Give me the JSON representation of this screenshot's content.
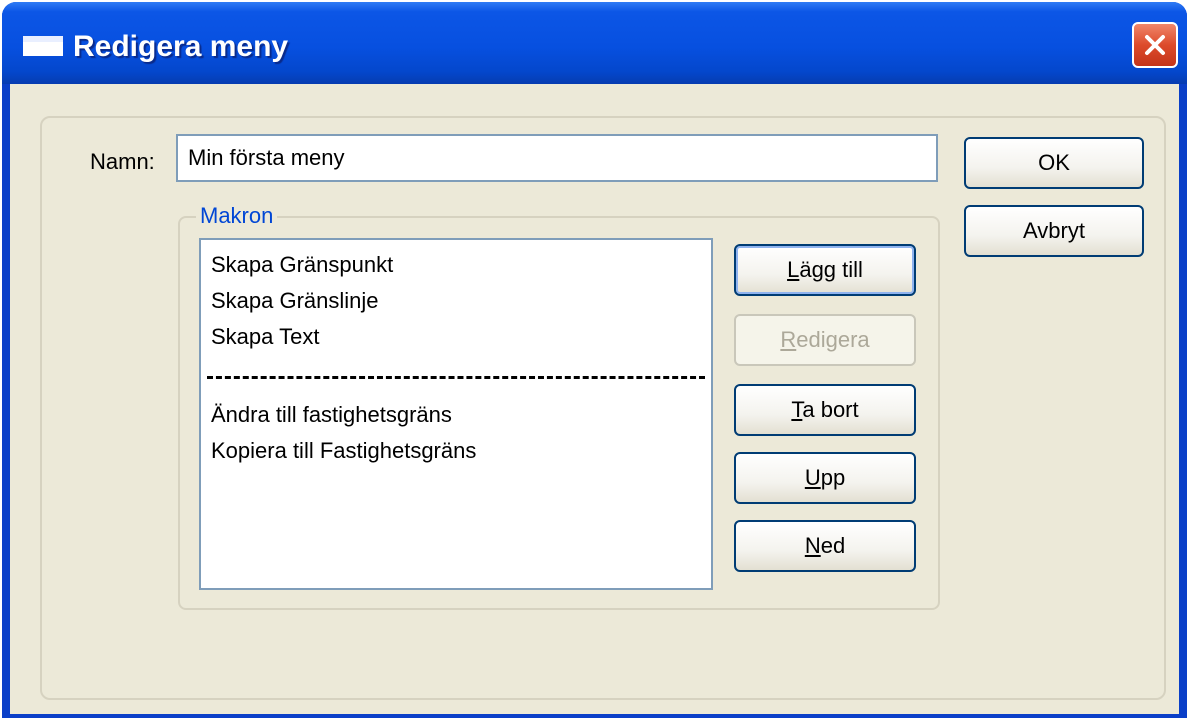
{
  "window": {
    "title": "Redigera meny"
  },
  "form": {
    "name_label": "Namn:",
    "name_value": "Min första meny"
  },
  "buttons": {
    "ok": "OK",
    "cancel": "Avbryt",
    "add": {
      "mnemonic": "L",
      "rest": "ägg till"
    },
    "edit": {
      "mnemonic": "R",
      "rest": "edigera"
    },
    "remove": {
      "mnemonic": "T",
      "rest": "a bort"
    },
    "up": {
      "mnemonic": "U",
      "rest": "pp"
    },
    "down": {
      "mnemonic": "N",
      "rest": "ed"
    }
  },
  "macros": {
    "legend": "Makron",
    "items": [
      "Skapa Gränspunkt",
      "Skapa Gränslinje",
      "Skapa Text",
      "Ändra till fastighetsgräns",
      "Kopiera till Fastighetsgräns"
    ]
  },
  "icons": {
    "window": "window-icon",
    "close": "close-icon"
  },
  "colors": {
    "titlebar": "#0750e0",
    "close_button": "#dd4b2b",
    "dialog_bg": "#ece9d8",
    "legend": "#0046d5"
  }
}
